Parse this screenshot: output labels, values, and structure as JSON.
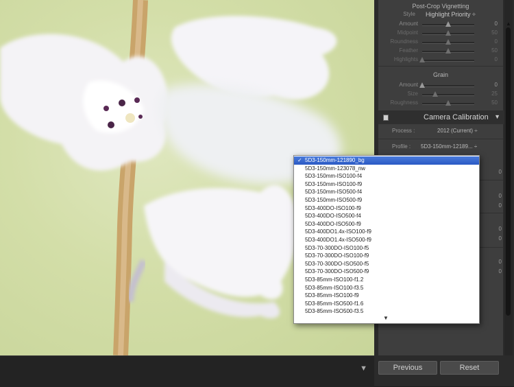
{
  "photo": {
    "chevron": "▼"
  },
  "panel": {
    "vignette": {
      "title": "Post-Crop Vignetting",
      "style_label": "Style",
      "style_value": "Highlight Priority ÷",
      "sliders": [
        {
          "label": "Amount",
          "value": "0",
          "level": 0.5,
          "dim": false
        },
        {
          "label": "Midpoint",
          "value": "50",
          "level": 0.5,
          "dim": true
        },
        {
          "label": "Roundness",
          "value": "0",
          "level": 0.5,
          "dim": true
        },
        {
          "label": "Feather",
          "value": "50",
          "level": 0.5,
          "dim": true
        },
        {
          "label": "Highlights",
          "value": "0",
          "level": 0.0,
          "dim": true
        }
      ]
    },
    "grain": {
      "title": "Grain",
      "sliders": [
        {
          "label": "Amount",
          "value": "0",
          "level": 0.0,
          "dim": false
        },
        {
          "label": "Size",
          "value": "25",
          "level": 0.25,
          "dim": true
        },
        {
          "label": "Roughness",
          "value": "50",
          "level": 0.5,
          "dim": true
        }
      ]
    },
    "calibration": {
      "title": "Camera Calibration",
      "triangle": "▼",
      "process_label": "Process :",
      "process_value": "2012 (Current) ÷",
      "profile_label": "Profile :",
      "profile_value": "5D3-150mm-12189... ÷"
    },
    "side_values": [
      "0",
      "0",
      "0",
      "0",
      "0",
      "0",
      "0"
    ],
    "buttons": {
      "previous": "Previous",
      "reset": "Reset"
    }
  },
  "menu": {
    "selected_mark": "✓",
    "items": [
      "5D3-150mm-121890_bg",
      "5D3-150mm-123078_nw",
      "5D3-150mm-ISO100-f4",
      "5D3-150mm-ISO100-f9",
      "5D3-150mm-ISO500-f4",
      "5D3-150mm-ISO500-f9",
      "5D3-400DO-ISO100-f9",
      "5D3-400DO-ISO500-f4",
      "5D3-400DO-ISO500-f9",
      "5D3-400DO1.4x-ISO100-f9",
      "5D3-400DO1.4x-ISO500-f9",
      "5D3-70-300DO-ISO100-f5",
      "5D3-70-300DO-ISO100-f9",
      "5D3-70-300DO-ISO500-f5",
      "5D3-70-300DO-ISO500-f9",
      "5D3-85mm-ISO100-f1.2",
      "5D3-85mm-ISO100-f3.5",
      "5D3-85mm-ISO100-f9",
      "5D3-85mm-ISO500-f1.6",
      "5D3-85mm-ISO500-f3.5"
    ],
    "more_arrow": "▼"
  }
}
